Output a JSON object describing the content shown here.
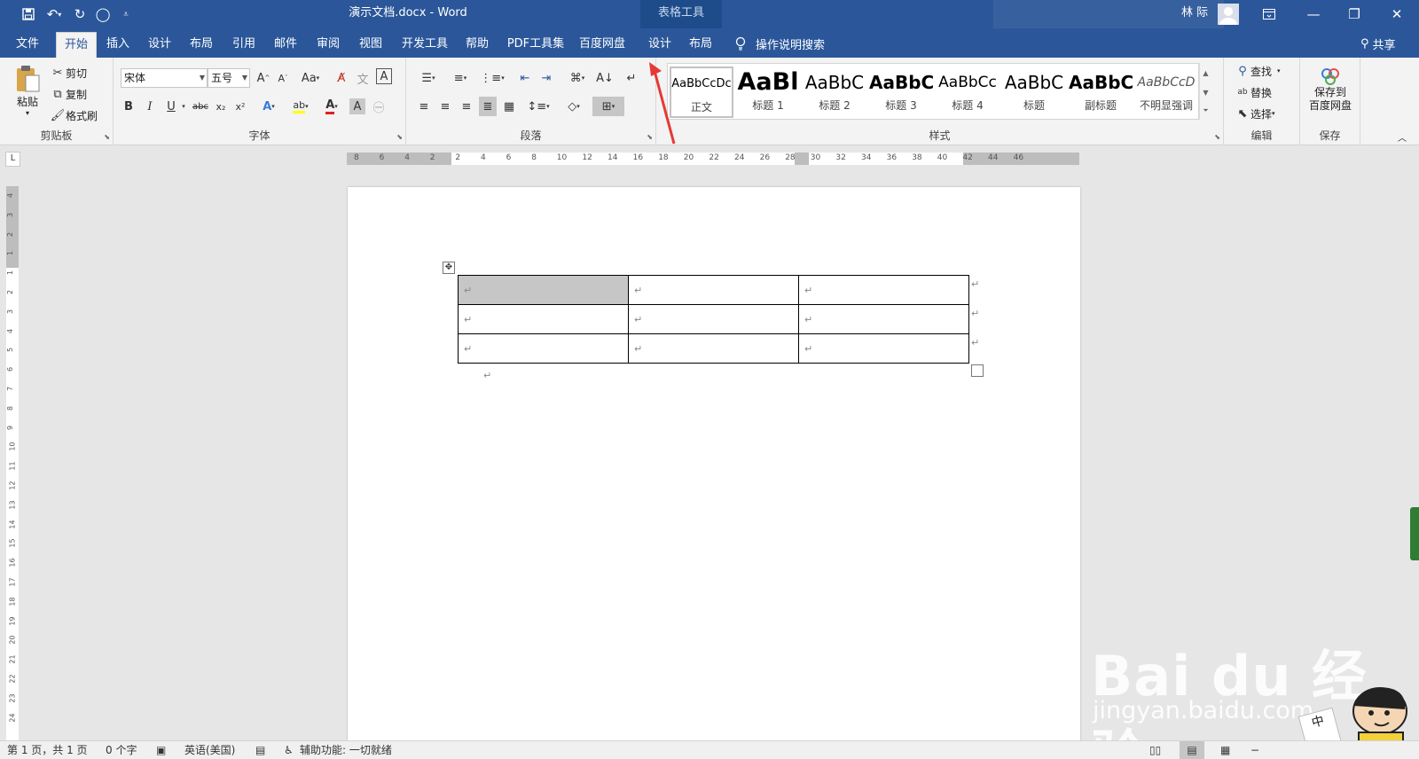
{
  "window": {
    "title": "演示文档.docx  -  Word",
    "contextual_group": "表格工具",
    "user_name": "林 际",
    "colors": {
      "title_bar": "#2b579a",
      "context_header": "#1e4c8a",
      "ribbon_bg": "#f3f3f3",
      "arrow": "#e53935"
    }
  },
  "qat": {
    "save_icon": "save-icon",
    "undo_icon": "undo-icon",
    "redo_icon": "redo-icon",
    "touch_icon": "touch-mode-icon",
    "customize_icon": "customize-qat-icon"
  },
  "tabs": [
    "文件",
    "开始",
    "插入",
    "设计",
    "布局",
    "引用",
    "邮件",
    "审阅",
    "视图",
    "开发工具",
    "帮助",
    "PDF工具集",
    "百度网盘",
    "设计",
    "布局"
  ],
  "active_tab": "开始",
  "tell_me": "操作说明搜索",
  "share": "共享",
  "clipboard": {
    "paste": "粘贴",
    "cut": "剪切",
    "copy": "复制",
    "format_painter": "格式刷",
    "label": "剪贴板"
  },
  "font": {
    "name": "宋体",
    "size": "五号",
    "label": "字体",
    "bold": "B",
    "italic": "I",
    "underline": "U",
    "strike": "abc",
    "subscript": "x₂",
    "superscript": "x²",
    "change_case": "Aa"
  },
  "paragraph": {
    "label": "段落"
  },
  "styles": {
    "label": "样式",
    "items": [
      {
        "preview": "AaBbCcDc",
        "name": "正文"
      },
      {
        "preview": "AaBl",
        "name": "标题 1"
      },
      {
        "preview": "AaBbC",
        "name": "标题 2"
      },
      {
        "preview": "AaBbC",
        "name": "标题 3"
      },
      {
        "preview": "AaBbCc",
        "name": "标题 4"
      },
      {
        "preview": "AaBbC",
        "name": "标题"
      },
      {
        "preview": "AaBbC",
        "name": "副标题"
      },
      {
        "preview": "AaBbCcD",
        "name": "不明显强调"
      }
    ]
  },
  "editing": {
    "find": "查找",
    "replace": "替换",
    "select": "选择",
    "label": "编辑"
  },
  "save_group": {
    "button": "保存到\n百度网盘",
    "line1": "保存到",
    "line2": "百度网盘",
    "label": "保存"
  },
  "ruler": {
    "corner": "L",
    "ticks": [
      "8",
      "6",
      "4",
      "2",
      "2",
      "4",
      "6",
      "8",
      "10",
      "12",
      "14",
      "16",
      "18",
      "20",
      "22",
      "24",
      "26",
      "28",
      "30",
      "32",
      "34",
      "36",
      "38",
      "40",
      "42",
      "44",
      "46"
    ],
    "vertical_ticks": [
      "4",
      "3",
      "2",
      "1",
      "1",
      "2",
      "3",
      "4",
      "5",
      "6",
      "7",
      "8",
      "9",
      "10",
      "11",
      "12",
      "13",
      "14",
      "15",
      "16",
      "17",
      "18",
      "19",
      "20",
      "21",
      "22",
      "23",
      "24"
    ]
  },
  "document": {
    "table": {
      "rows": 3,
      "cols": 3,
      "cells": [
        [
          "↵",
          "↵",
          "↵"
        ],
        [
          "↵",
          "↵",
          "↵"
        ],
        [
          "↵",
          "↵",
          "↵"
        ]
      ],
      "row_end_marks": [
        "↵",
        "↵",
        "↵"
      ],
      "selected_cell": "1,1"
    },
    "after_table_mark": "↵",
    "move_handle": "✥"
  },
  "status": {
    "page": "第 1 页，共 1 页",
    "words": "0 个字",
    "language": "英语(美国)",
    "accessibility": "辅助功能: 一切就绪"
  },
  "watermark": {
    "brand": "Bai du 经验",
    "url": "jingyan.baidu.com",
    "ime_char": "中"
  }
}
